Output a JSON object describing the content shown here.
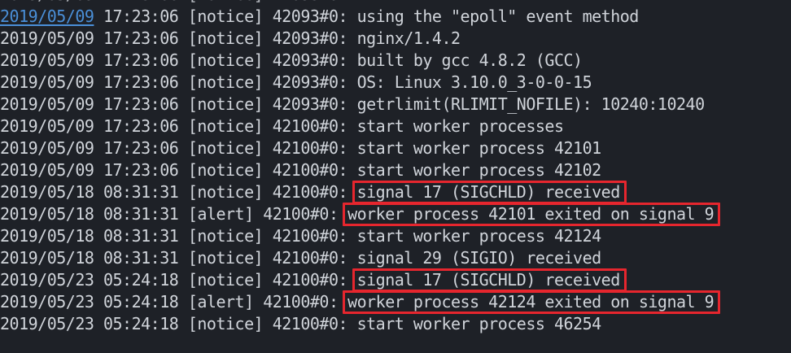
{
  "terminal": {
    "highlight_color": "#e6262e",
    "text_color": "#d0d4da",
    "background": "#1e2127",
    "link_color": "#4a8fd8",
    "cut_line": {
      "date": "2019/05/09",
      "time": "17:23:06",
      "level": "[notice]",
      "pid": "42093#0:",
      "message": "..."
    },
    "lines": [
      {
        "date": "2019/05/09",
        "time": "17:23:06",
        "level": "[notice]",
        "pid": "42093#0:",
        "message": "using the \"epoll\" event method",
        "highlighted": false
      },
      {
        "date": "2019/05/09",
        "time": "17:23:06",
        "level": "[notice]",
        "pid": "42093#0:",
        "message": "nginx/1.4.2",
        "highlighted": false
      },
      {
        "date": "2019/05/09",
        "time": "17:23:06",
        "level": "[notice]",
        "pid": "42093#0:",
        "message": "built by gcc 4.8.2 (GCC)",
        "highlighted": false
      },
      {
        "date": "2019/05/09",
        "time": "17:23:06",
        "level": "[notice]",
        "pid": "42093#0:",
        "message": "OS: Linux 3.10.0_3-0-0-15",
        "highlighted": false
      },
      {
        "date": "2019/05/09",
        "time": "17:23:06",
        "level": "[notice]",
        "pid": "42093#0:",
        "message": "getrlimit(RLIMIT_NOFILE): 10240:10240",
        "highlighted": false
      },
      {
        "date": "2019/05/09",
        "time": "17:23:06",
        "level": "[notice]",
        "pid": "42100#0:",
        "message": "start worker processes",
        "highlighted": false
      },
      {
        "date": "2019/05/09",
        "time": "17:23:06",
        "level": "[notice]",
        "pid": "42100#0:",
        "message": "start worker process 42101",
        "highlighted": false
      },
      {
        "date": "2019/05/09",
        "time": "17:23:06",
        "level": "[notice]",
        "pid": "42100#0:",
        "message": "start worker process 42102",
        "highlighted": false
      },
      {
        "date": "2019/05/18",
        "time": "08:31:31",
        "level": "[notice]",
        "pid": "42100#0:",
        "message": "signal 17 (SIGCHLD) received",
        "highlighted": true
      },
      {
        "date": "2019/05/18",
        "time": "08:31:31",
        "level": "[alert]",
        "pid": "42100#0:",
        "message": "worker process 42101 exited on signal 9",
        "highlighted": true
      },
      {
        "date": "2019/05/18",
        "time": "08:31:31",
        "level": "[notice]",
        "pid": "42100#0:",
        "message": "start worker process 42124",
        "highlighted": false
      },
      {
        "date": "2019/05/18",
        "time": "08:31:31",
        "level": "[notice]",
        "pid": "42100#0:",
        "message": "signal 29 (SIGIO) received",
        "highlighted": false
      },
      {
        "date": "2019/05/23",
        "time": "05:24:18",
        "level": "[notice]",
        "pid": "42100#0:",
        "message": "signal 17 (SIGCHLD) received",
        "highlighted": true
      },
      {
        "date": "2019/05/23",
        "time": "05:24:18",
        "level": "[alert]",
        "pid": "42100#0:",
        "message": "worker process 42124 exited on signal 9",
        "highlighted": true
      },
      {
        "date": "2019/05/23",
        "time": "05:24:18",
        "level": "[notice]",
        "pid": "42100#0:",
        "message": "start worker process 46254",
        "highlighted": false
      }
    ]
  }
}
